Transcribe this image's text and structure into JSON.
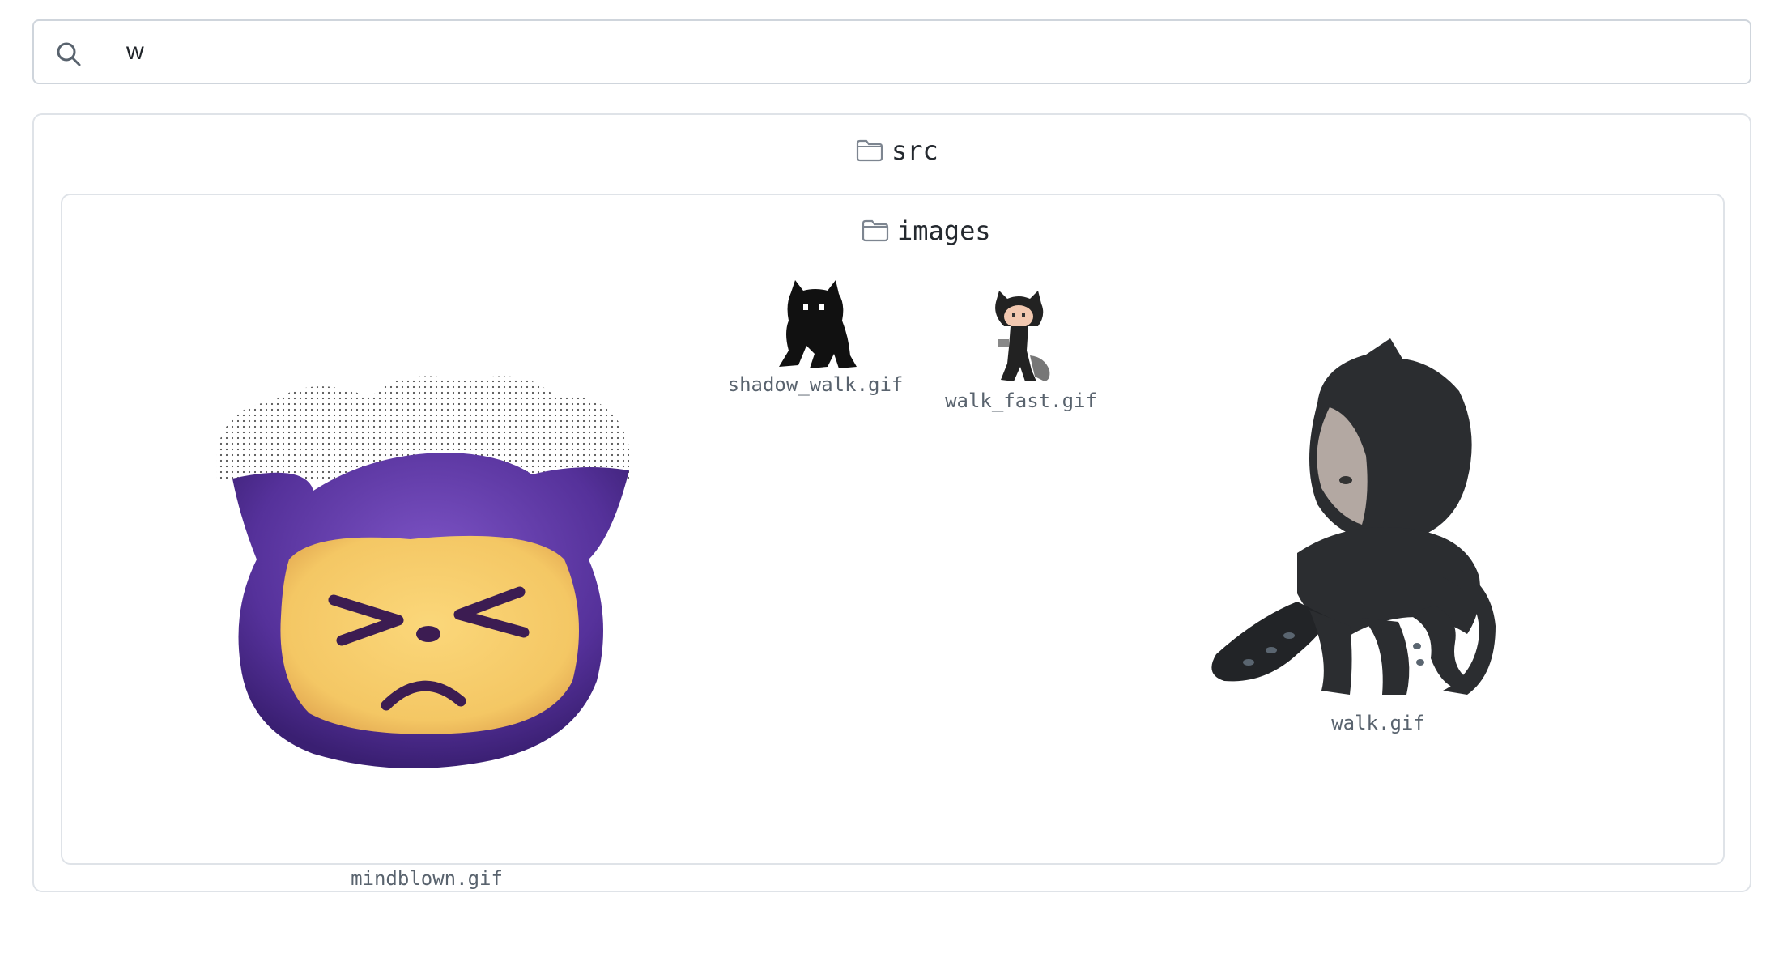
{
  "search": {
    "value": "w",
    "icon": "search-icon"
  },
  "tree": {
    "folder": {
      "name": "src",
      "icon": "folder-icon",
      "subfolder": {
        "name": "images",
        "icon": "folder-icon",
        "files": [
          {
            "name": "mindblown.gif",
            "thumbnail": "purple-cat-mindblown-icon"
          },
          {
            "name": "shadow_walk.gif",
            "thumbnail": "black-silhouette-cat-icon"
          },
          {
            "name": "walk_fast.gif",
            "thumbnail": "pixel-octocat-walking-icon"
          },
          {
            "name": "walk.gif",
            "thumbnail": "octocat-walking-icon"
          }
        ]
      }
    }
  }
}
